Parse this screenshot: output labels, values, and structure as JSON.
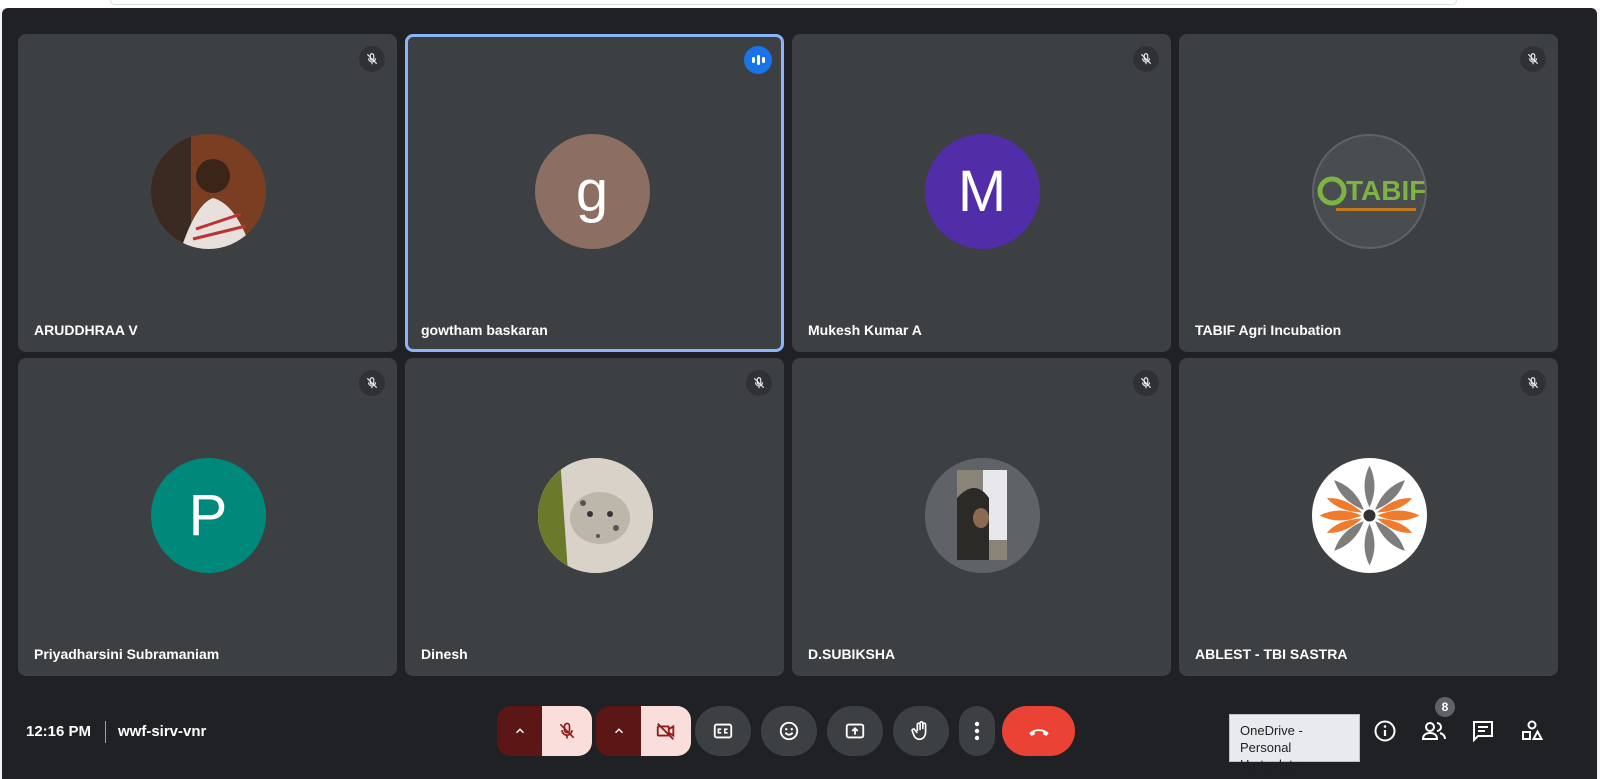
{
  "participants": [
    {
      "name": "ARUDDHRAA V",
      "avatar": "photo",
      "muted": true
    },
    {
      "name": "gowtham baskaran",
      "initial": "g",
      "avatar_color": "#8d6e63",
      "speaking": true
    },
    {
      "name": "Mukesh Kumar A",
      "initial": "M",
      "avatar_color": "#512da8",
      "muted": true
    },
    {
      "name": "TABIF Agri Incubation",
      "avatar": "logo",
      "logo_text": "TABIF",
      "muted": true
    },
    {
      "name": "Priyadharsini Subramaniam",
      "initial": "P",
      "avatar_color": "#00897b",
      "muted": true
    },
    {
      "name": "Dinesh",
      "avatar": "photo",
      "muted": true
    },
    {
      "name": "D.SUBIKSHA",
      "avatar": "photo",
      "muted": true
    },
    {
      "name": "ABLEST - TBI SASTRA",
      "avatar": "logo",
      "muted": true
    }
  ],
  "meeting": {
    "time": "12:16 PM",
    "code": "wwf-sirv-vnr",
    "participant_count": "8"
  },
  "tooltip": {
    "line1": "OneDrive - Personal",
    "line2": "Up to date"
  },
  "colors": {
    "tile_bg": "#3c4043",
    "background": "#202124",
    "active_border": "#8ab4f8",
    "end_call": "#ea4335",
    "muted_bg": "#f9dedc"
  },
  "icons": [
    "mic-off-icon",
    "speaking-icon",
    "caret-up-icon",
    "camera-off-icon",
    "captions-icon",
    "emoji-icon",
    "present-icon",
    "raise-hand-icon",
    "more-options-icon",
    "end-call-icon",
    "info-icon",
    "people-icon",
    "chat-icon",
    "activities-icon"
  ]
}
